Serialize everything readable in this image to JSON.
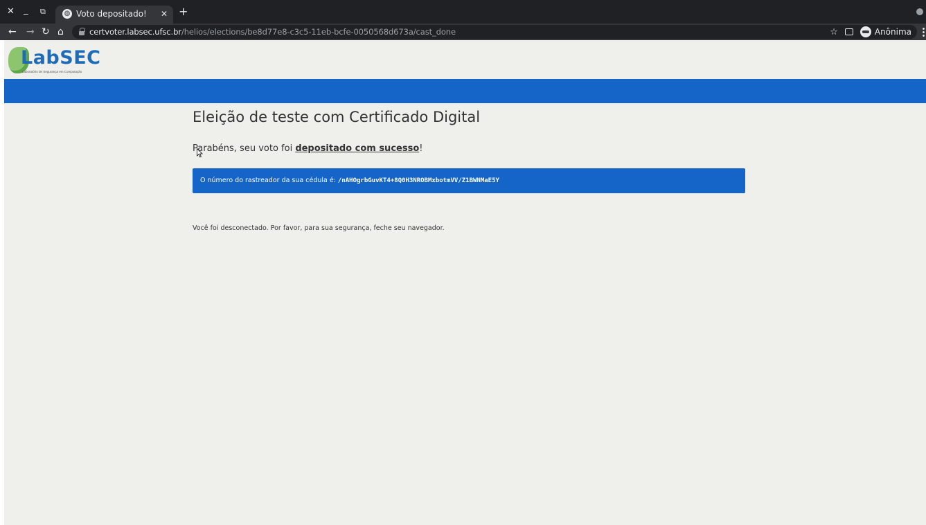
{
  "browser": {
    "tab_title": "Voto depositado!",
    "url_host": "certvoter.labsec.ufsc.br",
    "url_path": "/helios/elections/be8d77e8-c3c5-11eb-bcfe-0050568d673a/cast_done",
    "profile_name": "Anônima"
  },
  "logo": {
    "text": "LabSEC",
    "subtitle": "Laboratório de Segurança em Computação"
  },
  "page": {
    "election_title": "Eleição de teste com Certificado Digital",
    "congrats_prefix": "Parabéns, seu voto foi ",
    "congrats_strong": "depositado com sucesso",
    "congrats_suffix": "!",
    "tracker_label": "O número do rastreador da sua cédula é: ",
    "tracker_code": "/nAHOgrbGuvKT4+8Q0H3NROBMxbotmVV/Z1BWNMaE5Y",
    "logout_message": "Você foi desconectado. Por favor, para sua segurança, feche seu navegador."
  },
  "colors": {
    "brand_blue": "#1565c8",
    "page_bg": "#efefec",
    "chrome_dark": "#202124"
  }
}
